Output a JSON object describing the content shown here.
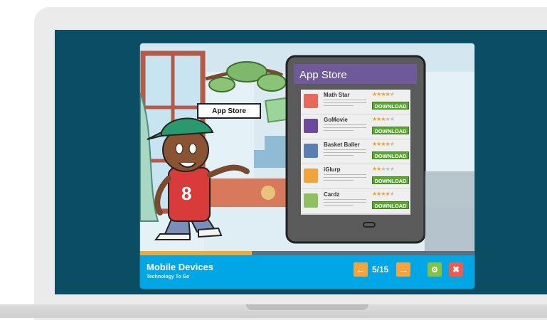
{
  "lesson": {
    "title": "Mobile Devices",
    "subtitle": "Technology To Go",
    "page_counter": "5/15",
    "progress_fraction": 0.333
  },
  "controls": {
    "prev_icon": "arrow-left-icon",
    "next_icon": "arrow-right-icon",
    "settings_icon": "gear-icon",
    "close_icon": "close-icon"
  },
  "scene": {
    "sign_text": "App Store",
    "character_shirt_number": "8"
  },
  "store": {
    "header": "App Store",
    "apps": [
      {
        "name": "Math Star",
        "rating": 4,
        "button": "DOWNLOAD",
        "icon": "math-icon",
        "icon_color": "#e8685a"
      },
      {
        "name": "GoMovie",
        "rating": 3,
        "button": "DOWNLOAD",
        "icon": "movie-icon",
        "icon_color": "#6a4a9c"
      },
      {
        "name": "Basket Baller",
        "rating": 4,
        "button": "DOWNLOAD",
        "icon": "basketball-icon",
        "icon_color": "#5a7fb0"
      },
      {
        "name": "iGlurp",
        "rating": 2,
        "button": "DOWNLOAD",
        "icon": "puzzle-icon",
        "icon_color": "#f0a43a"
      },
      {
        "name": "Cardz",
        "rating": 4,
        "button": "DOWNLOAD",
        "icon": "cards-icon",
        "icon_color": "#8cc060"
      }
    ]
  },
  "colors": {
    "screen_bg": "#0b4e64",
    "control_bar": "#00a6e6",
    "progress": "#f0a93b",
    "store_header": "#6e5a9b",
    "download": "#5aa82f"
  }
}
